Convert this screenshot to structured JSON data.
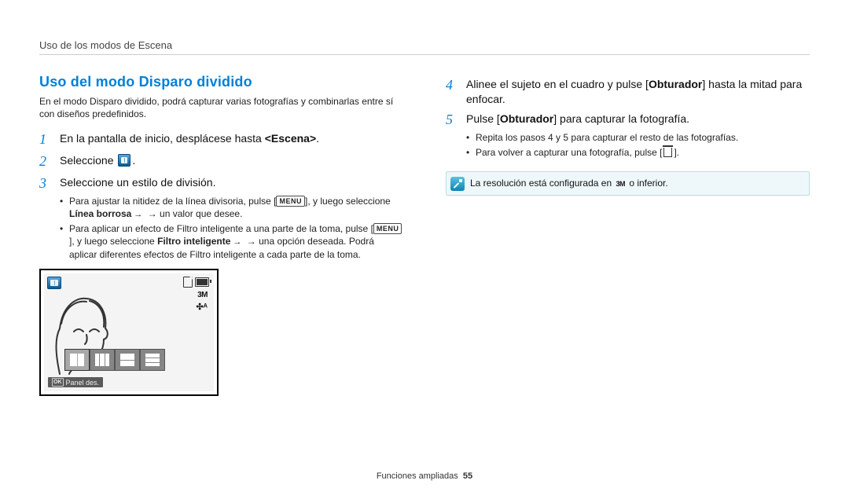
{
  "runningHead": "Uso de los modos de Escena",
  "sectionTitle": "Uso del modo Disparo dividido",
  "intro": "En el modo Disparo dividido, podrá capturar varias fotografías y combinarlas entre sí con diseños predefinidos.",
  "steps": {
    "1": {
      "num": "1",
      "pre": "En la pantalla de inicio, desplácese hasta ",
      "bold": "<Escena>",
      "post": "."
    },
    "2": {
      "num": "2",
      "text": "Seleccione",
      "post": "."
    },
    "3": {
      "num": "3",
      "text": "Seleccione un estilo de división."
    },
    "3a": {
      "pre": "Para ajustar la nitidez de la línea divisoria, pulse [",
      "menu": "MENU",
      "mid1": "], y luego seleccione ",
      "bold": "Línea borrosa",
      "mid2": " → un valor que desee."
    },
    "3b": {
      "pre": "Para aplicar un efecto de Filtro inteligente a una parte de la toma, pulse [",
      "menu": "MENU",
      "mid1": "], y luego seleccione ",
      "bold": "Filtro inteligente",
      "mid2": " → una opción deseada. Podrá aplicar diferentes efectos de Filtro inteligente a cada parte de la toma."
    },
    "4": {
      "num": "4",
      "pre": "Alinee el sujeto en el cuadro y pulse [",
      "bold": "Obturador",
      "post": "] hasta la mitad para enfocar."
    },
    "5": {
      "num": "5",
      "pre": "Pulse [",
      "bold": "Obturador",
      "post": "] para capturar la fotografía."
    },
    "5a": "Repita los pasos 4 y 5 para capturar el resto de las fotografías.",
    "5b": {
      "pre": "Para volver a capturar una fotografía, pulse [",
      "post": "]."
    }
  },
  "lcd": {
    "res": "3M",
    "flash": "✣ᴬ",
    "bottom": "Panel des.",
    "ok": "OK"
  },
  "note": {
    "pre": "La resolución está configurada en ",
    "icon": "3M",
    "post": " o inferior."
  },
  "footer": {
    "label": "Funciones ampliadas",
    "page": "55"
  }
}
